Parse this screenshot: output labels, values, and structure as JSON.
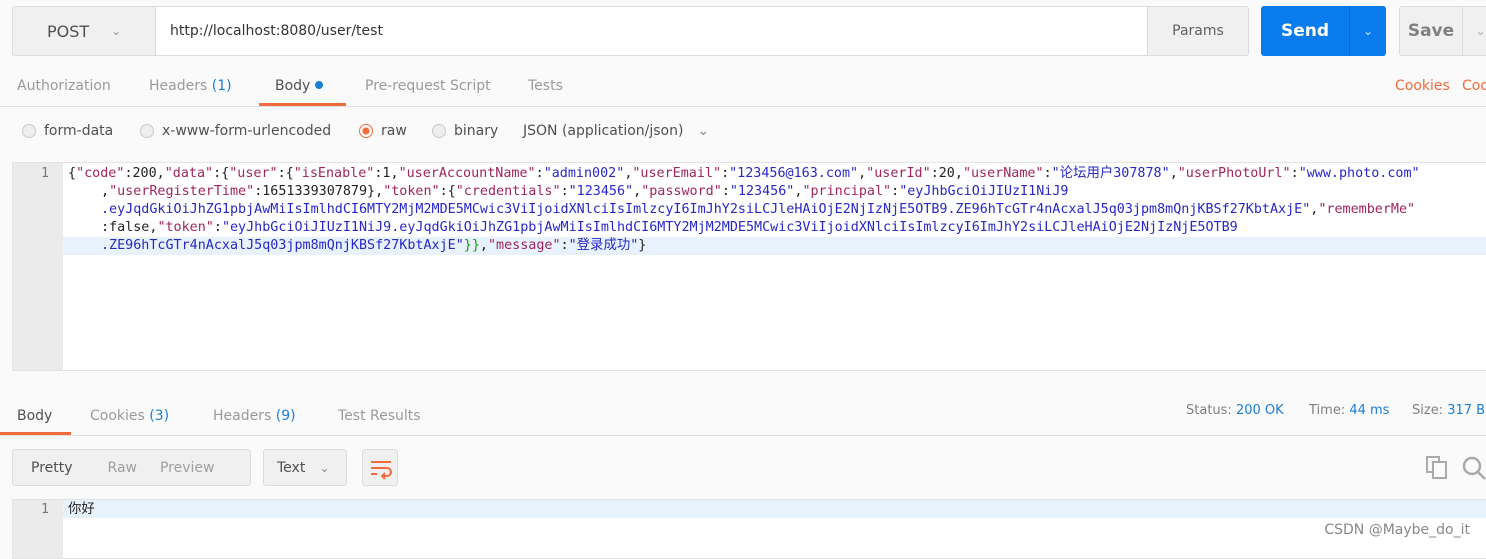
{
  "request": {
    "method": "POST",
    "url": "http://localhost:8080/user/test",
    "params_label": "Params",
    "send_label": "Send",
    "save_label": "Save"
  },
  "request_tabs": [
    {
      "label": "Authorization"
    },
    {
      "label": "Headers",
      "count": "(1)"
    },
    {
      "label": "Body"
    },
    {
      "label": "Pre-request Script"
    },
    {
      "label": "Tests"
    }
  ],
  "cookies_link": "Cookies",
  "code_link": "Code",
  "body_types": [
    {
      "label": "form-data",
      "selected": false
    },
    {
      "label": "x-www-form-urlencoded",
      "selected": false
    },
    {
      "label": "raw",
      "selected": true
    },
    {
      "label": "binary",
      "selected": false
    }
  ],
  "content_type": "JSON (application/json)",
  "accent_color": "#f26b3a",
  "send_color": "#097bed",
  "request_body": {
    "line_number": "1",
    "lines": [
      [
        [
          "p",
          "{"
        ],
        [
          "k",
          "\"code\""
        ],
        [
          "p",
          ":200,"
        ],
        [
          "k",
          "\"data\""
        ],
        [
          "p",
          ":{"
        ],
        [
          "k",
          "\"user\""
        ],
        [
          "p",
          ":{"
        ],
        [
          "k",
          "\"isEnable\""
        ],
        [
          "p",
          ":1,"
        ],
        [
          "k",
          "\"userAccountName\""
        ],
        [
          "p",
          ":"
        ],
        [
          "s",
          "\"admin002\""
        ],
        [
          "p",
          ","
        ],
        [
          "k",
          "\"userEmail\""
        ],
        [
          "p",
          ":"
        ],
        [
          "s",
          "\"123456@163.com\""
        ],
        [
          "p",
          ","
        ],
        [
          "k",
          "\"userId\""
        ],
        [
          "p",
          ":20,"
        ],
        [
          "k",
          "\"userName\""
        ],
        [
          "p",
          ":"
        ],
        [
          "s",
          "\"论坛用户307878\""
        ],
        [
          "p",
          ","
        ],
        [
          "k",
          "\"userPhotoUrl\""
        ],
        [
          "p",
          ":"
        ],
        [
          "s",
          "\"www.photo.com\""
        ]
      ],
      [
        [
          "p",
          ",\u0000"
        ],
        [
          "k",
          "\"userRegisterTime\""
        ],
        [
          "p",
          ":1651339307879},"
        ],
        [
          "k",
          "\"token\""
        ],
        [
          "p",
          ":{"
        ],
        [
          "k",
          "\"credentials\""
        ],
        [
          "p",
          ":"
        ],
        [
          "s",
          "\"123456\""
        ],
        [
          "p",
          ","
        ],
        [
          "k",
          "\"password\""
        ],
        [
          "p",
          ":"
        ],
        [
          "s",
          "\"123456\""
        ],
        [
          "p",
          ","
        ],
        [
          "k",
          "\"principal\""
        ],
        [
          "p",
          ":"
        ],
        [
          "s",
          "\"eyJhbGciOiJIUzI1NiJ9"
        ]
      ],
      [
        [
          "s",
          ".eyJqdGkiOiJhZG1pbjAwMiIsImlhdCI6MTY2MjM2MDE5MCwic3ViIjoidXNlciIsImlzcyI6ImJhY2siLCJleHAiOjE2NjIzNjE5OTB9.ZE96hTcGTr4nAcxalJ5q03jpm8mQnjKBSf27KbtAxjE\""
        ],
        [
          "p",
          ","
        ],
        [
          "k",
          "\"rememberMe\""
        ]
      ],
      [
        [
          "p",
          ":false,"
        ],
        [
          "k",
          "\"token\""
        ],
        [
          "p",
          ":"
        ],
        [
          "s",
          "\"eyJhbGciOiJIUzI1NiJ9.eyJqdGkiOiJhZG1pbjAwMiIsImlhdCI6MTY2MjM2MDE5MCwic3ViIjoidXNlciIsImlzcyI6ImJhY2siLCJleHAiOjE2NjIzNjE5OTB9"
        ]
      ],
      [
        [
          "s",
          ".ZE96hTcGTr4nAcxalJ5q03jpm8mQnjKBSf27KbtAxjE\""
        ],
        [
          "g",
          "}}"
        ],
        [
          "p",
          ","
        ],
        [
          "k",
          "\"message\""
        ],
        [
          "p",
          ":"
        ],
        [
          "s",
          "\"登录成功\""
        ],
        [
          "p",
          "}"
        ]
      ]
    ]
  },
  "response_tabs": [
    {
      "label": "Body"
    },
    {
      "label": "Cookies",
      "count": "(3)"
    },
    {
      "label": "Headers",
      "count": "(9)"
    },
    {
      "label": "Test Results"
    }
  ],
  "status": {
    "status_label": "Status:",
    "status_value": "200 OK",
    "time_label": "Time:",
    "time_value": "44 ms",
    "size_label": "Size:",
    "size_value": "317 B"
  },
  "view_modes": [
    "Pretty",
    "Raw",
    "Preview"
  ],
  "format": "Text",
  "response_body": {
    "line_number": "1",
    "text": "你好"
  },
  "watermark": "CSDN @Maybe_do_it"
}
